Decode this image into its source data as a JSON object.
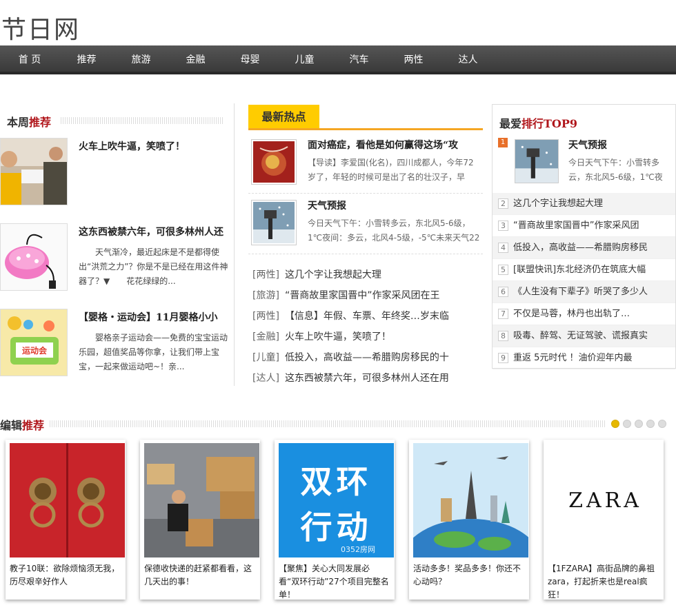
{
  "site": {
    "logo": "节日网"
  },
  "nav": [
    "首 页",
    "推荐",
    "旅游",
    "金融",
    "母婴",
    "儿童",
    "汽车",
    "两性",
    "达人"
  ],
  "weekly": {
    "title_a": "本周",
    "title_b": "推荐",
    "items": [
      {
        "title": "火车上吹牛逼，笑喷了！",
        "desc": ""
      },
      {
        "title": "这东西被禁六年，可很多林州人还",
        "desc": "天气渐冷，最近起床是不是都得使出“洪荒之力”？你是不是已经在用这件神器了？▼　　花花绿绿的..."
      },
      {
        "title": "【婴格・运动会】11月婴格小小",
        "desc": "婴格亲子运动会——免费的宝宝运动乐园，超值奖品等你拿，让我们带上宝宝，一起来做运动吧~！亲..."
      }
    ]
  },
  "hot": {
    "tab": "最新热点",
    "featured": [
      {
        "title": "面对癌症，看他是如何赢得这场“攻",
        "desc": "【导读】李爱国(化名)，四川成都人，今年72岁了，年轻的时候可是出了名的壮汉子，早"
      },
      {
        "title": "天气预报",
        "desc": "今日天气下午：小雪转多云，东北风5-6级，1℃夜间：多云，北风4-5级，-5℃未来天气22"
      }
    ],
    "list": [
      {
        "cat": "[两性]",
        "text": "这几个字让我想起大理"
      },
      {
        "cat": "[旅游]",
        "text": "“晋商故里家国晋中”作家采风团在王"
      },
      {
        "cat": "[两性]",
        "text": "【信息】年假、车票、年终奖…岁末临"
      },
      {
        "cat": "[金融]",
        "text": "火车上吹牛逼，笑喷了！"
      },
      {
        "cat": "[儿童]",
        "text": "低投入，高收益——希腊购房移民的十"
      },
      {
        "cat": "[达人]",
        "text": "这东西被禁六年，可很多林州人还在用"
      }
    ]
  },
  "rank": {
    "title_a": "最爱",
    "title_b": "排行TOP9",
    "top1": {
      "num": "1",
      "title": "天气预报",
      "desc": "今日天气下午：小雪转多云，东北风5-6级，1℃夜"
    },
    "items": [
      {
        "num": "2",
        "text": "这几个字让我想起大理"
      },
      {
        "num": "3",
        "text": "“晋商故里家国晋中”作家采风团"
      },
      {
        "num": "4",
        "text": "低投入，高收益——希腊购房移民"
      },
      {
        "num": "5",
        "text": "[联盟快讯]东北经济仍在筑底大幅"
      },
      {
        "num": "6",
        "text": "《人生没有下辈子》听哭了多少人"
      },
      {
        "num": "7",
        "text": "不仅是马蓉，林丹也出轨了…"
      },
      {
        "num": "8",
        "text": "吸毒、醉驾、无证驾驶、谎报真实"
      },
      {
        "num": "9",
        "text": "重返 5元时代 ！油价迎年内最"
      }
    ]
  },
  "editor": {
    "title_a": "编辑",
    "title_b": "推荐",
    "slides_active": 1,
    "cards": [
      {
        "caption": "教子10联：欲除烦恼须无我，历尽艰辛好作人"
      },
      {
        "caption": "保德收快递的赶紧都看看，这几天出的事！"
      },
      {
        "caption": "【聚焦】关心大同发展必看“双环行动”27个项目完整名单！",
        "img_text_a": "双环",
        "img_text_b": "行动",
        "img_watermark": "0352房网"
      },
      {
        "caption": "活动多多！奖品多多！你还不心动吗？"
      },
      {
        "caption": "【1FZARA】高街品牌的鼻祖zara，打起折来也是real疯狂！",
        "img_text": "ZARA"
      }
    ]
  },
  "colors": {
    "accent": "#b0161b",
    "hot_tab": "#ffcc00",
    "nav_bg": "#4a4a4a"
  }
}
